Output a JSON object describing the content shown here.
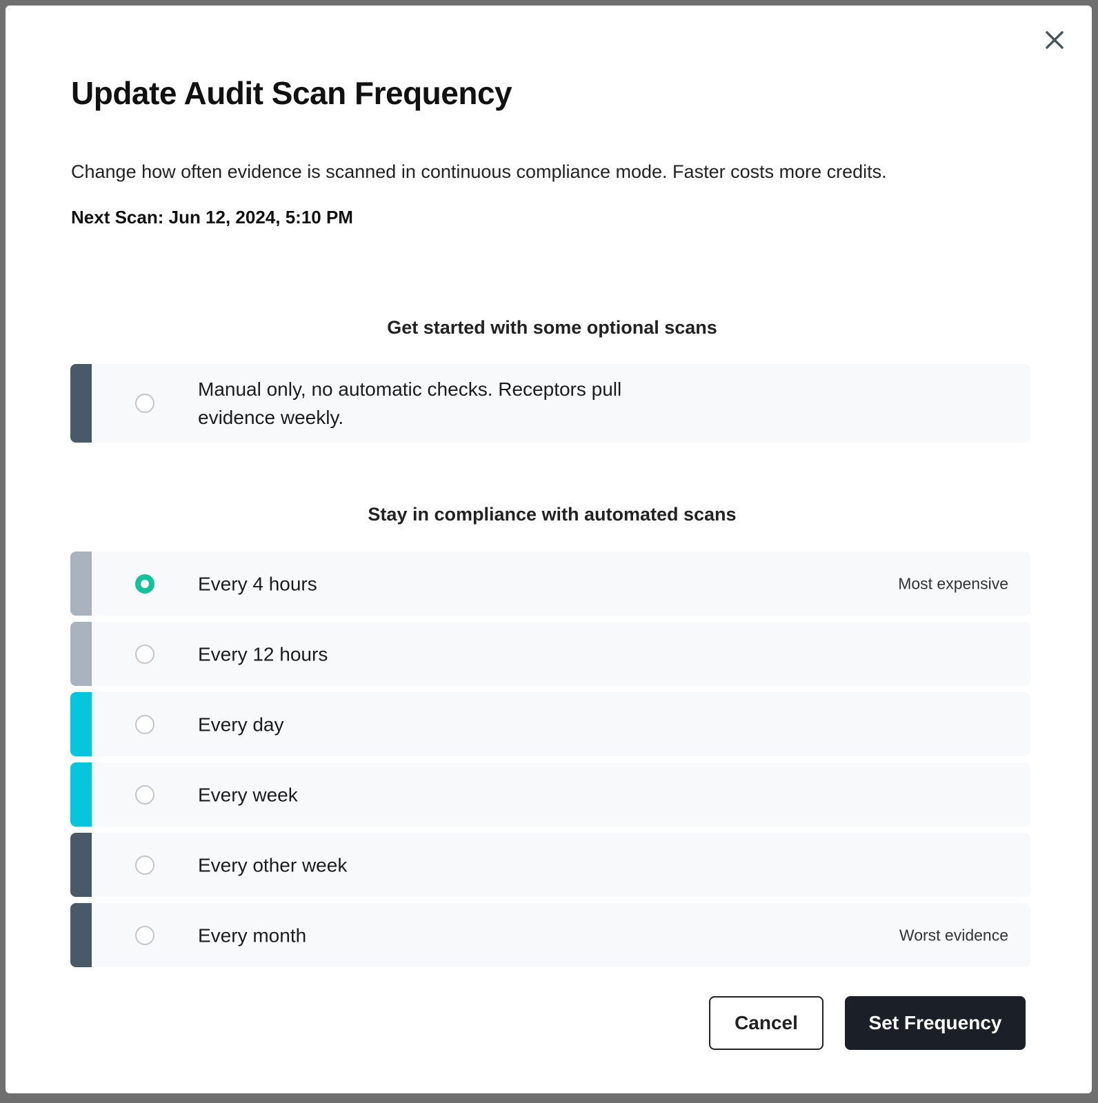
{
  "dialog": {
    "title": "Update Audit Scan Frequency",
    "description": "Change how often evidence is scanned in continuous compliance mode. Faster costs more credits.",
    "next_scan": "Next Scan: Jun 12, 2024, 5:10 PM"
  },
  "sections": {
    "optional": {
      "heading": "Get started with some optional scans",
      "options": [
        {
          "label": "Manual only, no automatic checks. Receptors pull evidence weekly.",
          "tag": "",
          "selected": false,
          "bar_color": "#4a5968"
        }
      ]
    },
    "automated": {
      "heading": "Stay in compliance with automated scans",
      "options": [
        {
          "label": "Every 4 hours",
          "tag": "Most expensive",
          "selected": true,
          "bar_color": "#a9b3bd"
        },
        {
          "label": "Every 12 hours",
          "tag": "",
          "selected": false,
          "bar_color": "#a9b3bd"
        },
        {
          "label": "Every day",
          "tag": "",
          "selected": false,
          "bar_color": "#06c5dd"
        },
        {
          "label": "Every week",
          "tag": "",
          "selected": false,
          "bar_color": "#06c5dd"
        },
        {
          "label": "Every other week",
          "tag": "",
          "selected": false,
          "bar_color": "#4a5968"
        },
        {
          "label": "Every month",
          "tag": "Worst evidence",
          "selected": false,
          "bar_color": "#4a5968"
        }
      ]
    }
  },
  "footer": {
    "cancel_label": "Cancel",
    "submit_label": "Set Frequency"
  },
  "icons": {
    "close": "close-icon"
  },
  "colors": {
    "selected_radio": "#12c39a",
    "primary_button": "#1b2028"
  }
}
